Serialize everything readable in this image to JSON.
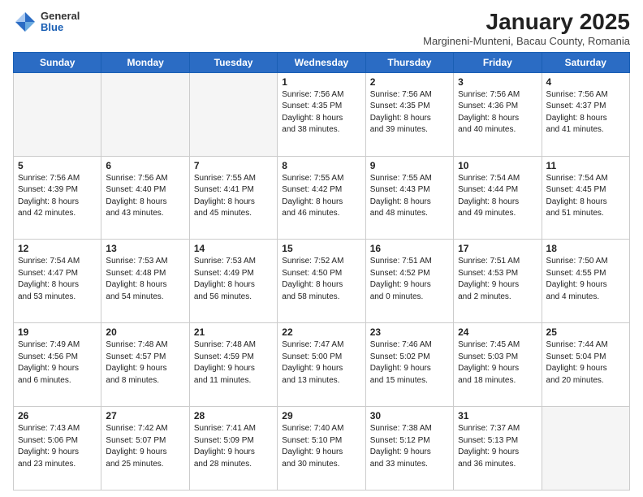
{
  "header": {
    "logo_general": "General",
    "logo_blue": "Blue",
    "month_title": "January 2025",
    "location": "Margineni-Munteni, Bacau County, Romania"
  },
  "days_of_week": [
    "Sunday",
    "Monday",
    "Tuesday",
    "Wednesday",
    "Thursday",
    "Friday",
    "Saturday"
  ],
  "weeks": [
    [
      {
        "day": "",
        "info": ""
      },
      {
        "day": "",
        "info": ""
      },
      {
        "day": "",
        "info": ""
      },
      {
        "day": "1",
        "info": "Sunrise: 7:56 AM\nSunset: 4:35 PM\nDaylight: 8 hours\nand 38 minutes."
      },
      {
        "day": "2",
        "info": "Sunrise: 7:56 AM\nSunset: 4:35 PM\nDaylight: 8 hours\nand 39 minutes."
      },
      {
        "day": "3",
        "info": "Sunrise: 7:56 AM\nSunset: 4:36 PM\nDaylight: 8 hours\nand 40 minutes."
      },
      {
        "day": "4",
        "info": "Sunrise: 7:56 AM\nSunset: 4:37 PM\nDaylight: 8 hours\nand 41 minutes."
      }
    ],
    [
      {
        "day": "5",
        "info": "Sunrise: 7:56 AM\nSunset: 4:39 PM\nDaylight: 8 hours\nand 42 minutes."
      },
      {
        "day": "6",
        "info": "Sunrise: 7:56 AM\nSunset: 4:40 PM\nDaylight: 8 hours\nand 43 minutes."
      },
      {
        "day": "7",
        "info": "Sunrise: 7:55 AM\nSunset: 4:41 PM\nDaylight: 8 hours\nand 45 minutes."
      },
      {
        "day": "8",
        "info": "Sunrise: 7:55 AM\nSunset: 4:42 PM\nDaylight: 8 hours\nand 46 minutes."
      },
      {
        "day": "9",
        "info": "Sunrise: 7:55 AM\nSunset: 4:43 PM\nDaylight: 8 hours\nand 48 minutes."
      },
      {
        "day": "10",
        "info": "Sunrise: 7:54 AM\nSunset: 4:44 PM\nDaylight: 8 hours\nand 49 minutes."
      },
      {
        "day": "11",
        "info": "Sunrise: 7:54 AM\nSunset: 4:45 PM\nDaylight: 8 hours\nand 51 minutes."
      }
    ],
    [
      {
        "day": "12",
        "info": "Sunrise: 7:54 AM\nSunset: 4:47 PM\nDaylight: 8 hours\nand 53 minutes."
      },
      {
        "day": "13",
        "info": "Sunrise: 7:53 AM\nSunset: 4:48 PM\nDaylight: 8 hours\nand 54 minutes."
      },
      {
        "day": "14",
        "info": "Sunrise: 7:53 AM\nSunset: 4:49 PM\nDaylight: 8 hours\nand 56 minutes."
      },
      {
        "day": "15",
        "info": "Sunrise: 7:52 AM\nSunset: 4:50 PM\nDaylight: 8 hours\nand 58 minutes."
      },
      {
        "day": "16",
        "info": "Sunrise: 7:51 AM\nSunset: 4:52 PM\nDaylight: 9 hours\nand 0 minutes."
      },
      {
        "day": "17",
        "info": "Sunrise: 7:51 AM\nSunset: 4:53 PM\nDaylight: 9 hours\nand 2 minutes."
      },
      {
        "day": "18",
        "info": "Sunrise: 7:50 AM\nSunset: 4:55 PM\nDaylight: 9 hours\nand 4 minutes."
      }
    ],
    [
      {
        "day": "19",
        "info": "Sunrise: 7:49 AM\nSunset: 4:56 PM\nDaylight: 9 hours\nand 6 minutes."
      },
      {
        "day": "20",
        "info": "Sunrise: 7:48 AM\nSunset: 4:57 PM\nDaylight: 9 hours\nand 8 minutes."
      },
      {
        "day": "21",
        "info": "Sunrise: 7:48 AM\nSunset: 4:59 PM\nDaylight: 9 hours\nand 11 minutes."
      },
      {
        "day": "22",
        "info": "Sunrise: 7:47 AM\nSunset: 5:00 PM\nDaylight: 9 hours\nand 13 minutes."
      },
      {
        "day": "23",
        "info": "Sunrise: 7:46 AM\nSunset: 5:02 PM\nDaylight: 9 hours\nand 15 minutes."
      },
      {
        "day": "24",
        "info": "Sunrise: 7:45 AM\nSunset: 5:03 PM\nDaylight: 9 hours\nand 18 minutes."
      },
      {
        "day": "25",
        "info": "Sunrise: 7:44 AM\nSunset: 5:04 PM\nDaylight: 9 hours\nand 20 minutes."
      }
    ],
    [
      {
        "day": "26",
        "info": "Sunrise: 7:43 AM\nSunset: 5:06 PM\nDaylight: 9 hours\nand 23 minutes."
      },
      {
        "day": "27",
        "info": "Sunrise: 7:42 AM\nSunset: 5:07 PM\nDaylight: 9 hours\nand 25 minutes."
      },
      {
        "day": "28",
        "info": "Sunrise: 7:41 AM\nSunset: 5:09 PM\nDaylight: 9 hours\nand 28 minutes."
      },
      {
        "day": "29",
        "info": "Sunrise: 7:40 AM\nSunset: 5:10 PM\nDaylight: 9 hours\nand 30 minutes."
      },
      {
        "day": "30",
        "info": "Sunrise: 7:38 AM\nSunset: 5:12 PM\nDaylight: 9 hours\nand 33 minutes."
      },
      {
        "day": "31",
        "info": "Sunrise: 7:37 AM\nSunset: 5:13 PM\nDaylight: 9 hours\nand 36 minutes."
      },
      {
        "day": "",
        "info": ""
      }
    ]
  ]
}
